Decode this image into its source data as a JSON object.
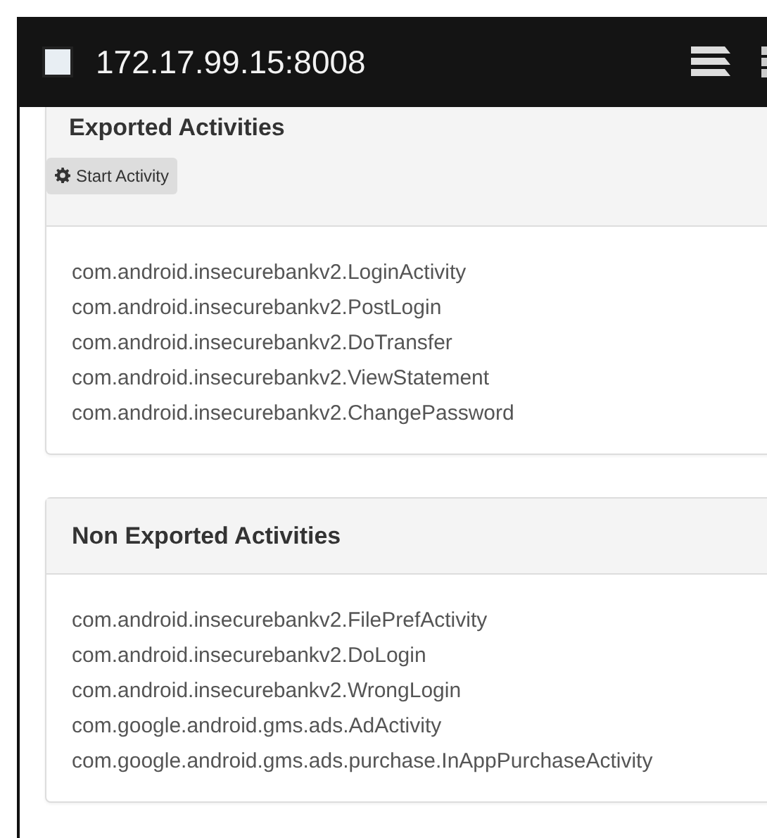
{
  "address_bar": {
    "url": "172.17.99.15:8008"
  },
  "panels": [
    {
      "title": "Exported Activities",
      "button": "Start Activity",
      "items": [
        "com.android.insecurebankv2.LoginActivity",
        "com.android.insecurebankv2.PostLogin",
        "com.android.insecurebankv2.DoTransfer",
        "com.android.insecurebankv2.ViewStatement",
        "com.android.insecurebankv2.ChangePassword"
      ]
    },
    {
      "title": "Non Exported Activities",
      "items": [
        "com.android.insecurebankv2.FilePrefActivity",
        "com.android.insecurebankv2.DoLogin",
        "com.android.insecurebankv2.WrongLogin",
        "com.google.android.gms.ads.AdActivity",
        "com.google.android.gms.ads.purchase.InAppPurchaseActivity"
      ]
    }
  ]
}
